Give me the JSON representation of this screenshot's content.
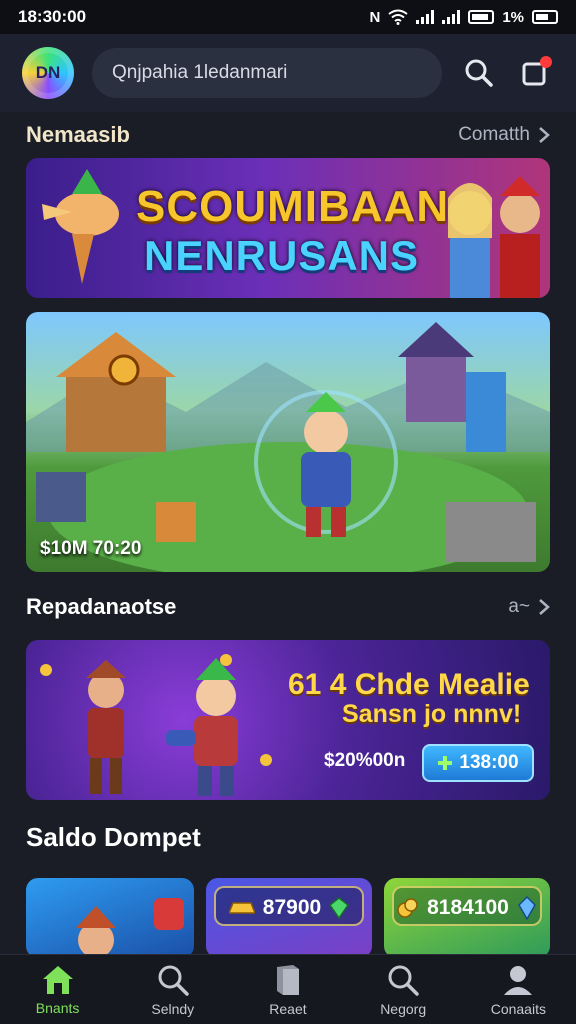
{
  "status_bar": {
    "time": "18:30:00",
    "icons_text": "N",
    "battery_text": "1%"
  },
  "header": {
    "logo_text": "DN",
    "search_placeholder": "Qnjpahia 1ledanmari"
  },
  "section1": {
    "title": "Nemaasib",
    "link": "Comatth"
  },
  "banner1": {
    "line1": "SCOUMIBAAN",
    "line2": "NENRUSANS"
  },
  "banner2": {
    "label": "$10M 70:20"
  },
  "section2": {
    "title": "Repadanaotse",
    "link": "a~"
  },
  "banner3": {
    "line1": "61  4 Chde Mealie",
    "line2": "Sansn jo nnnv!",
    "price": "$20%00n",
    "button_label": "138:00"
  },
  "wallet": {
    "title": "Saldo Dompet",
    "cards": [
      {
        "value": ""
      },
      {
        "value": "87900"
      },
      {
        "value": "8184100"
      }
    ]
  },
  "bottom_nav": {
    "items": [
      {
        "label": "Bnants",
        "icon": "home-icon"
      },
      {
        "label": "Selndy",
        "icon": "search-icon"
      },
      {
        "label": "Reaet",
        "icon": "book-icon"
      },
      {
        "label": "Negorg",
        "icon": "search-icon"
      },
      {
        "label": "Conaaits",
        "icon": "profile-icon"
      }
    ]
  },
  "colors": {
    "background": "#1a1d26",
    "accent_green": "#7fe05a",
    "gold": "#f7c52c",
    "cyan": "#4ad3ff"
  }
}
